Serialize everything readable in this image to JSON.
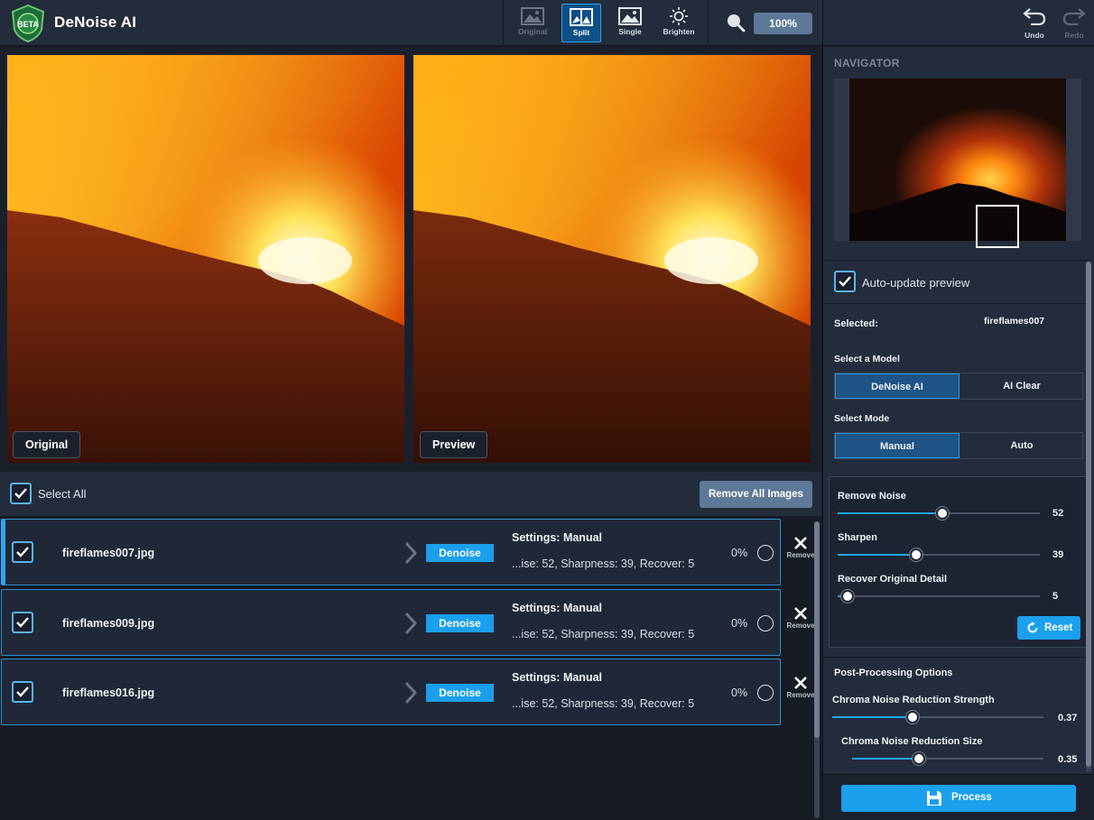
{
  "app": {
    "title": "DeNoise AI",
    "logo_badge": "BETA"
  },
  "toolbar": {
    "views": [
      {
        "label": "Original",
        "state": "disabled"
      },
      {
        "label": "Split",
        "state": "active"
      },
      {
        "label": "Single",
        "state": "normal"
      },
      {
        "label": "Brighten",
        "state": "normal"
      }
    ],
    "zoom_level": "100%",
    "undo_label": "Undo",
    "redo_label": "Redo"
  },
  "preview": {
    "left_label": "Original",
    "right_label": "Preview"
  },
  "list": {
    "select_all_label": "Select All",
    "select_all_checked": true,
    "remove_all_label": "Remove All Images",
    "rows": [
      {
        "file": "fireflames007.jpg",
        "checked": true,
        "selected": true,
        "action": "Denoise",
        "settings_title": "Settings: Manual",
        "settings_values": "...ise: 52, Sharpness: 39, Recover: 5",
        "progress": "0%",
        "remove_label": "Remove"
      },
      {
        "file": "fireflames009.jpg",
        "checked": true,
        "selected": false,
        "action": "Denoise",
        "settings_title": "Settings: Manual",
        "settings_values": "...ise: 52, Sharpness: 39, Recover: 5",
        "progress": "0%",
        "remove_label": "Remove"
      },
      {
        "file": "fireflames016.jpg",
        "checked": true,
        "selected": false,
        "action": "Denoise",
        "settings_title": "Settings: Manual",
        "settings_values": "...ise: 52, Sharpness: 39, Recover: 5",
        "progress": "0%",
        "remove_label": "Remove"
      }
    ]
  },
  "panel": {
    "navigator_title": "NAVIGATOR",
    "auto_update_label": "Auto-update preview",
    "auto_update_checked": true,
    "selected_label": "Selected:",
    "selected_value": "fireflames007",
    "model_label": "Select a Model",
    "model_options": [
      "DeNoise AI",
      "AI Clear"
    ],
    "model_selected": "DeNoise AI",
    "mode_label": "Select Mode",
    "mode_options": [
      "Manual",
      "Auto"
    ],
    "mode_selected": "Manual",
    "sliders": [
      {
        "label": "Remove Noise",
        "value": "52",
        "fraction": 0.52
      },
      {
        "label": "Sharpen",
        "value": "39",
        "fraction": 0.39
      },
      {
        "label": "Recover Original Detail",
        "value": "5",
        "fraction": 0.05
      }
    ],
    "reset_label": "Reset",
    "post_title": "Post-Processing Options",
    "post_sliders": [
      {
        "label": "Chroma Noise Reduction Strength",
        "value": "0.37",
        "fraction": 0.38
      },
      {
        "label": "Chroma Noise Reduction Size",
        "value": "0.35",
        "fraction": 0.35
      }
    ],
    "process_label": "Process"
  },
  "colors": {
    "accent": "#1aa0ec",
    "panel_bg": "#232c3b",
    "app_bg": "#161b24",
    "selection_border": "#2d8fd0"
  }
}
